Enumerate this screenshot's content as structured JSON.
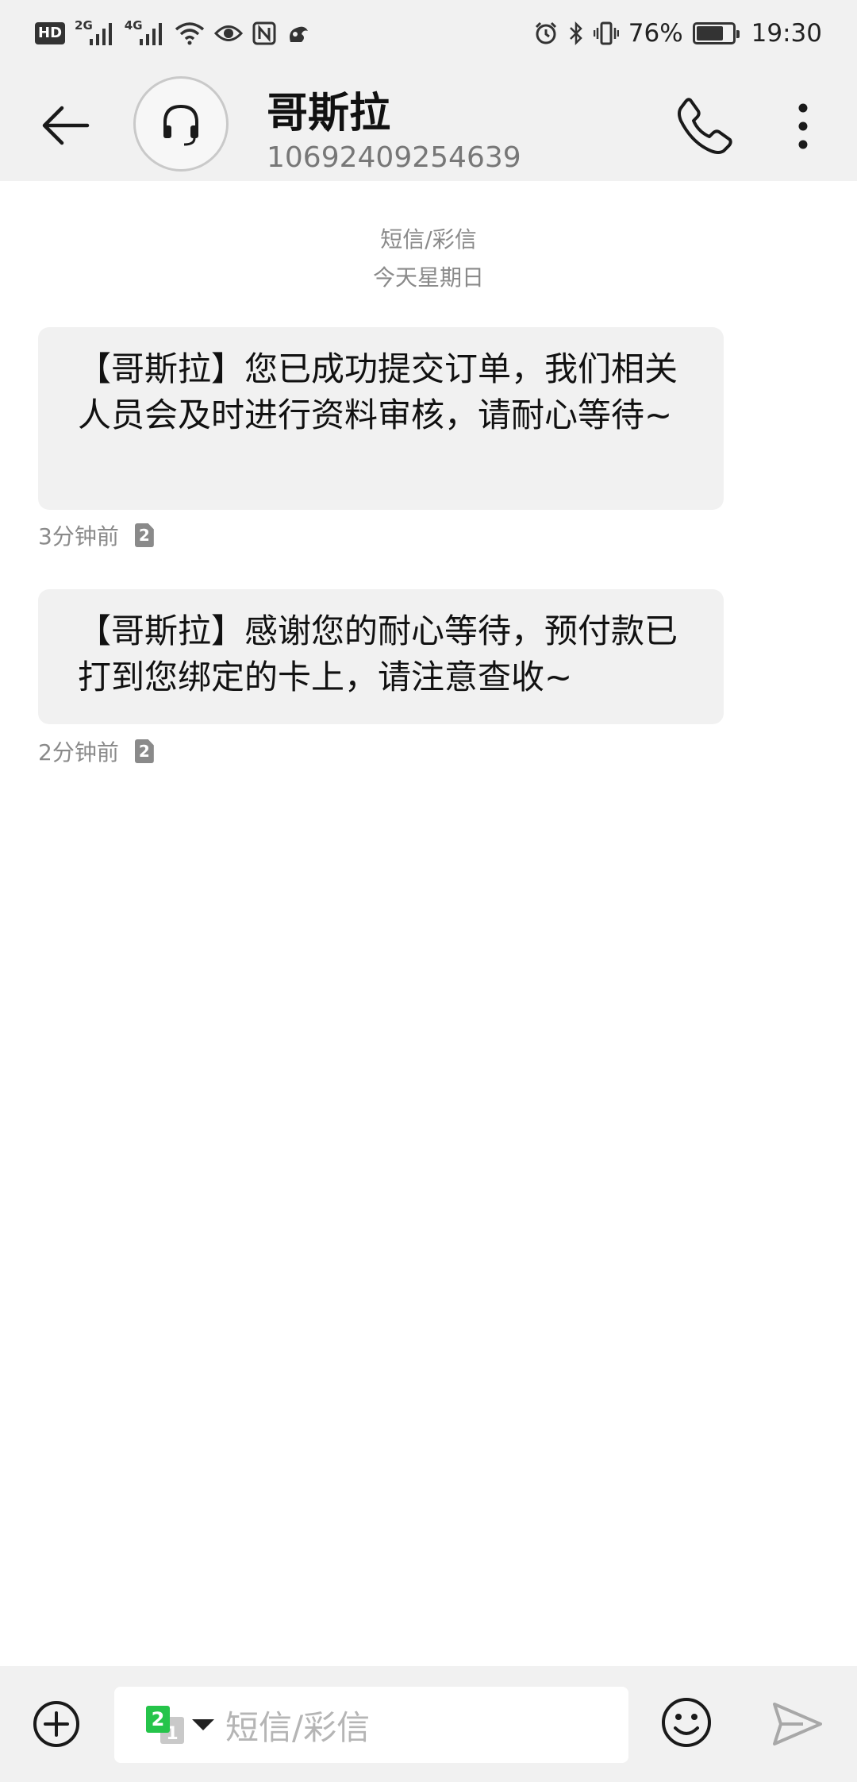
{
  "status_bar": {
    "hd": "HD",
    "net1": "2G",
    "net2": "4G",
    "battery_percent": "76%",
    "battery_level": 0.76,
    "time": "19:30",
    "icons_left": [
      "hd-icon",
      "signal-2g-icon",
      "signal-4g-icon",
      "wifi-icon",
      "eye-icon",
      "nfc-icon",
      "squirrel-icon"
    ],
    "icons_right": [
      "alarm-icon",
      "bluetooth-icon",
      "vibrate-icon",
      "battery-icon"
    ]
  },
  "header": {
    "contact_name": "哥斯拉",
    "contact_number": "10692409254639",
    "icons": [
      "back-arrow-icon",
      "headset-icon",
      "phone-icon",
      "more-vertical-icon"
    ]
  },
  "thread": {
    "type_label": "短信/彩信",
    "day_label": "今天星期日"
  },
  "messages": [
    {
      "text": "【哥斯拉】您已成功提交订单，我们相关人员会及时进行资料审核，请耐心等待~",
      "time": "3分钟前",
      "sim": "2"
    },
    {
      "text": "【哥斯拉】感谢您的耐心等待，预付款已打到您绑定的卡上，请注意查收~",
      "time": "2分钟前",
      "sim": "2"
    }
  ],
  "composer": {
    "placeholder": "短信/彩信",
    "sim_front": "2",
    "sim_back": "1",
    "icons": [
      "add-icon",
      "sim-switch-icon",
      "emoji-icon",
      "send-icon"
    ]
  },
  "colors": {
    "bar_bg": "#f1f1f1",
    "bubble_bg": "#f1f1f1",
    "meta_text": "#8a8a8a",
    "sim_green": "#25c44a"
  }
}
